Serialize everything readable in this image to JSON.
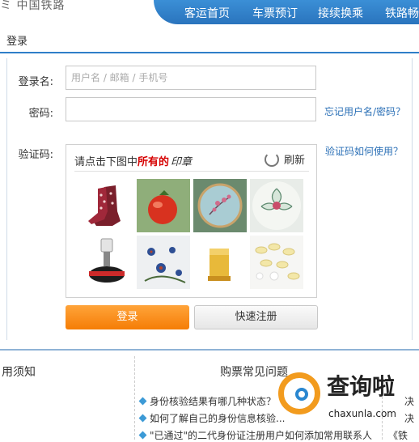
{
  "header": {
    "logo_fragment": "ミ 中国铁路",
    "nav": [
      "客运首页",
      "车票预订",
      "接续换乘",
      "铁路畅"
    ]
  },
  "login": {
    "title": "登录",
    "username_label": "登录名:",
    "username_placeholder": "用户名 / 邮箱 / 手机号",
    "password_label": "密码:",
    "forgot_link": "忘记用户名/密码？",
    "captcha_label": "验证码:",
    "captcha_help_link": "验证码如何使用？",
    "captcha_prompt_prefix": "请点击下图中",
    "captcha_prompt_highlight": "所有的",
    "captcha_prompt_target": "印章",
    "refresh_label": "刷新",
    "login_button": "登录",
    "register_button": "快速注册"
  },
  "captcha_tiles": [
    {
      "name": "boots-tile"
    },
    {
      "name": "tomato-tile"
    },
    {
      "name": "embroidery-tile"
    },
    {
      "name": "flower-plate-tile"
    },
    {
      "name": "stamp-tile"
    },
    {
      "name": "porcelain-tile"
    },
    {
      "name": "seal-tile"
    },
    {
      "name": "pills-tile"
    }
  ],
  "bottom": {
    "left_heading": "用须知",
    "mid_heading": "购票常见问题",
    "faq": [
      "身份核验结果有哪几种状态？",
      "如何了解自己的身份信息核验...",
      "\"已通过\"的二代身份证注册用户如何添加常用联系人"
    ],
    "right_fragments": [
      "决",
      "决",
      "《铁"
    ]
  },
  "watermark": {
    "title": "查询啦",
    "url": "chaxunla.com"
  }
}
